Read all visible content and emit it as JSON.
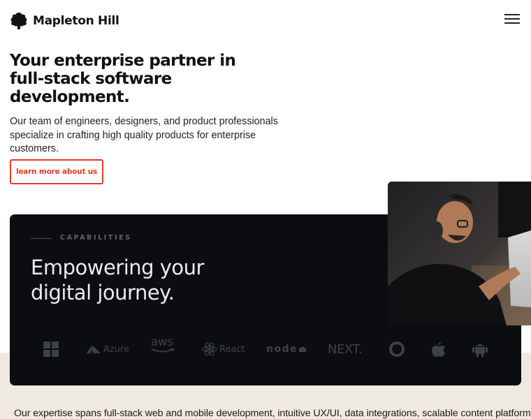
{
  "brand": {
    "name": "Mapleton Hill"
  },
  "hero": {
    "title": "Your enterprise partner in full-stack software development.",
    "subtitle": "Our team of engineers, designers, and product professionals specialize in crafting high quality products for enterprise customers.",
    "cta_label": "learn more about us"
  },
  "capabilities": {
    "label": "CAPABILITIES",
    "title": "Empowering your digital journey.",
    "technologies": [
      {
        "name": "windows-icon"
      },
      {
        "name": "azure-logo",
        "text": "Azure"
      },
      {
        "name": "aws-logo",
        "text": "aws"
      },
      {
        "name": "react-logo",
        "text": "React"
      },
      {
        "name": "nodejs-logo",
        "text": "node"
      },
      {
        "name": "nextjs-logo",
        "text": "NEXT."
      },
      {
        "name": "circle-logo"
      },
      {
        "name": "apple-icon"
      },
      {
        "name": "android-icon"
      }
    ]
  },
  "expertise_text": "Our expertise spans full-stack web and mobile development, intuitive UX/UI, data integrations, scalable content platforms,",
  "colors": {
    "accent": "#e43a2f",
    "dark_card": "#0b0d10",
    "beige": "#efe9df"
  }
}
